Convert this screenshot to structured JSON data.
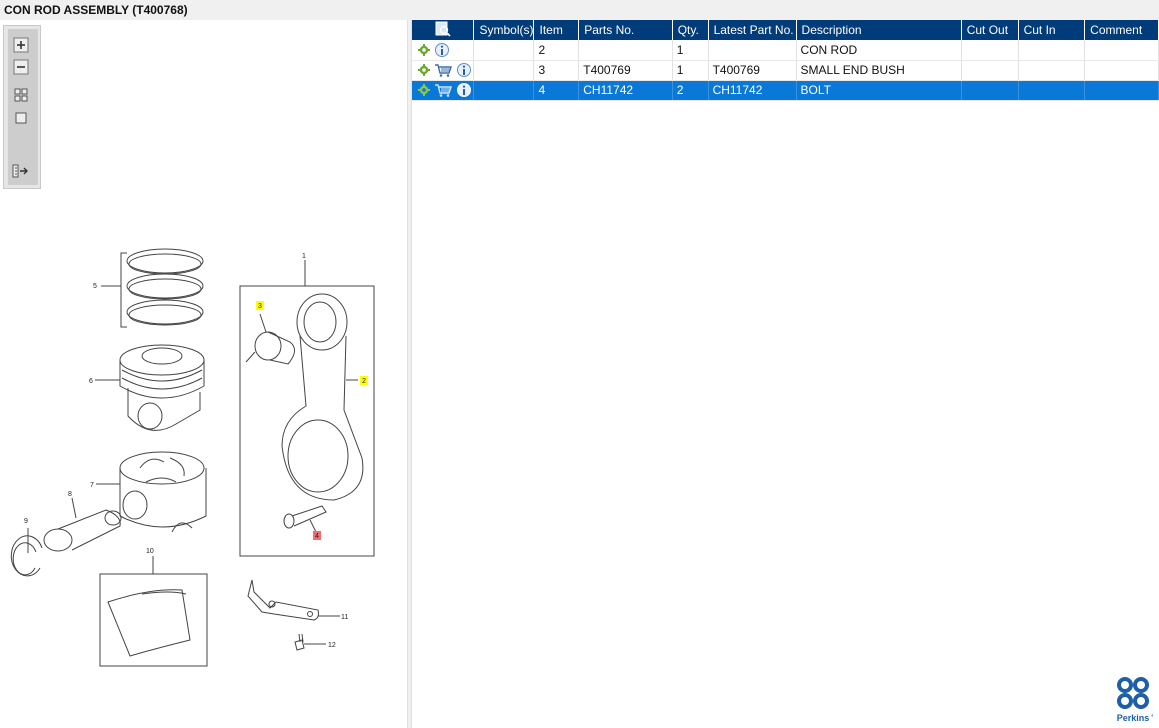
{
  "window": {
    "title": "CON ROD ASSEMBLY (T400768)"
  },
  "table": {
    "columns": [
      "",
      "Symbol(s)",
      "Item",
      "Parts No.",
      "Qty.",
      "Latest Part No.",
      "Description",
      "Cut Out",
      "Cut In",
      "Comment"
    ],
    "rows": [
      {
        "item": "2",
        "parts_no": "",
        "qty": "1",
        "latest": "",
        "description": "CON ROD",
        "cart": false,
        "selected": false
      },
      {
        "item": "3",
        "parts_no": "T400769",
        "qty": "1",
        "latest": "T400769",
        "description": "SMALL END BUSH",
        "cart": true,
        "selected": false
      },
      {
        "item": "4",
        "parts_no": "CH11742",
        "qty": "2",
        "latest": "CH11742",
        "description": "BOLT",
        "cart": true,
        "selected": true
      }
    ]
  },
  "diagram": {
    "callouts": [
      "1",
      "2",
      "3",
      "4",
      "5",
      "6",
      "7",
      "8",
      "9",
      "10",
      "11",
      "12"
    ]
  },
  "logo": {
    "text": "Perkins",
    "trademark": "®",
    "color": "#1d5fa8"
  },
  "colors": {
    "header": "#003b7a",
    "selected_row": "#0a78d7",
    "gear": "#6aa82e",
    "highlight_yellow": "#ffff00",
    "highlight_red": "#f07070"
  },
  "icons": [
    "zoom-in-icon",
    "zoom-out-icon",
    "thumbnails-icon",
    "fit-icon",
    "panel-toggle-icon",
    "gear-icon",
    "info-icon",
    "cart-icon",
    "magnifier-document-icon"
  ]
}
